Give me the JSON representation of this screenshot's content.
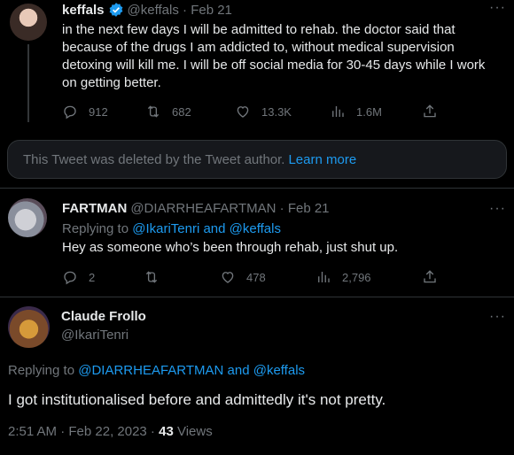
{
  "tweet1": {
    "name": "keffals",
    "handle": "@keffals",
    "date": "Feb 21",
    "text": "in the next few days I will be admitted to rehab. the doctor said that because of the drugs I am addicted to, without medical supervision detoxing will kill me. I will be off social media for 30-45 days while I work on getting better.",
    "replies": "912",
    "retweets": "682",
    "likes": "13.3K",
    "views": "1.6M"
  },
  "deleted": {
    "text": "This Tweet was deleted by the Tweet author.",
    "link": "Learn more"
  },
  "tweet2": {
    "name": "FARTMAN",
    "handle": "@DIARRHEAFARTMAN",
    "date": "Feb 21",
    "reply_prefix": "Replying to",
    "reply_users": "@IkariTenri and @keffals",
    "text": "Hey as someone who’s been through rehab, just shut up.",
    "replies": "2",
    "retweets": "",
    "likes": "478",
    "views": "2,796"
  },
  "tweet3": {
    "name": "Claude Frollo",
    "handle": "@IkariTenri",
    "reply_prefix": "Replying to",
    "reply_users": "@DIARRHEAFARTMAN and @keffals",
    "text": "I got institutionalised before and admittedly it's not pretty.",
    "timestamp": "2:51 AM · Feb 22, 2023 ·",
    "view_count": "43",
    "views_label": "Views"
  },
  "colors": {
    "accent": "#1d9bf0",
    "verified": "#1d9bf0",
    "muted": "#71767b"
  }
}
